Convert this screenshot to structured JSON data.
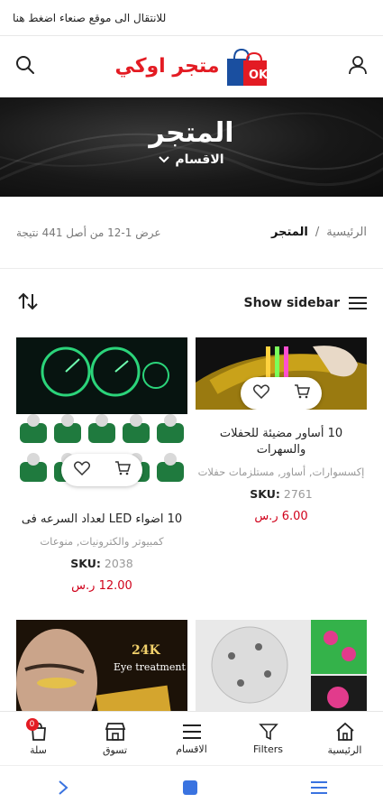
{
  "topbar": {
    "link_text": "للانتقال الى موقع صنعاء اضغط هنا"
  },
  "header": {
    "logo_text": "متجر اوكي",
    "logo_badge": "OK"
  },
  "hero": {
    "title": "المتجر",
    "categories_label": "الاقسام"
  },
  "breadcrumb": {
    "home": "الرئيسية",
    "separator": "/",
    "current": "المتجر"
  },
  "results": {
    "text": "عرض 1-12 من أصل 441 نتيجة"
  },
  "toolbar": {
    "show_sidebar": "Show sidebar"
  },
  "products": [
    {
      "title": "10 أساور مضيئة للحفلات والسهرات",
      "categories": "إكسسوارات, أساور, مستلزمات حفلات",
      "sku_label": "SKU:",
      "sku": "2761",
      "price": "6.00 ر.س"
    },
    {
      "title": "10 اضواء LED لعداد السرعه فى",
      "categories": "كمبيوتر والكترونيات, منوعات",
      "sku_label": "SKU:",
      "sku": "2038",
      "price": "12.00 ر.س"
    }
  ],
  "promo_text": {
    "gold": "24K",
    "treatment": "Eye treatment"
  },
  "bottom_nav": [
    {
      "label": "الرئيسية",
      "icon": "home-icon"
    },
    {
      "label": "Filters",
      "icon": "filter-icon"
    },
    {
      "label": "الاقسام",
      "icon": "menu-icon"
    },
    {
      "label": "تسوق",
      "icon": "store-icon"
    },
    {
      "label": "سلة",
      "icon": "cart-icon",
      "badge": "0"
    }
  ],
  "colors": {
    "brand_red": "#e31b23",
    "price_red": "#d0021b",
    "hero_bg": "#181818"
  }
}
